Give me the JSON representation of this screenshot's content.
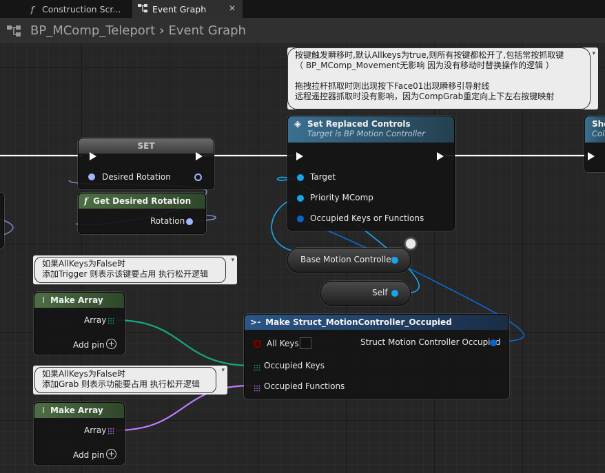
{
  "tabs": [
    {
      "label": "Construction Scr...",
      "icon": "function-icon",
      "active": false
    },
    {
      "label": "Event Graph",
      "icon": "graph-icon",
      "active": true,
      "close": "✕"
    }
  ],
  "breadcrumb": {
    "blueprint": "BP_MComp_Teleport",
    "separator": "›",
    "graph": "Event Graph"
  },
  "nodes": {
    "set": {
      "title": "SET",
      "pin_desired_rotation": "Desired Rotation"
    },
    "get_desired_rotation": {
      "title": "Get Desired Rotation",
      "icon": "function-icon",
      "out_rotation": "Rotation"
    },
    "set_replaced_controls": {
      "title": "Set Replaced Controls",
      "subtitle": "Target is BP Motion Controller",
      "pin_target": "Target",
      "pin_priority": "Priority MComp",
      "pin_occupied": "Occupied Keys or Functions"
    },
    "base_motion_controller": {
      "label": "Base Motion Controller"
    },
    "self": {
      "label": "Self"
    },
    "make_struct": {
      "title": "Make Struct_MotionController_Occupied",
      "pin_all_keys": "All Keys",
      "pin_occupied_keys": "Occupied Keys",
      "pin_occupied_functions": "Occupied Functions",
      "out_struct": "Struct Motion Controller Occupied"
    },
    "make_array_1": {
      "title": "Make Array",
      "out_array": "Array",
      "add_pin": "Add pin"
    },
    "make_array_2": {
      "title": "Make Array",
      "out_array": "Array",
      "add_pin": "Add pin"
    },
    "offscreen": {
      "title": "Sho",
      "subtitle": "Coll"
    }
  },
  "comments": {
    "top_line1": "按键触发瞬移时,默认Allkeys为true,则所有按键都松开了,包括常按抓取键",
    "top_line2": "（ BP_MComp_Movement无影响 因为没有移动时替换操作的逻辑 ）",
    "top_line3": "拖拽拉杆抓取时则出现按下Face01出现瞬移引导射线",
    "top_line4": "远程遥控器抓取时没有影响，因为CompGrab重定向上下左右按键映射",
    "c1_line1": "如果AllKeys为False时",
    "c1_line2": "添加Trigger 则表示该键要占用 执行松开逻辑",
    "c2_line1": "如果AllKeys为False时",
    "c2_line2": "添加Grab 则表示功能要占用 执行松开逻辑"
  },
  "colors": {
    "exec": "#ffffff",
    "object_pin": "#19a4e8",
    "struct_pin": "#0b63c9",
    "rotator_pin": "#a0b4ff",
    "array_green": "#14a883",
    "array_purple": "#c47bff",
    "bool_pin": "#8b0000",
    "set_header": "#5a5a5a",
    "function_header": "#2e5f7c",
    "pure_header": "#3b5632",
    "struct_header": "#1f4470"
  }
}
